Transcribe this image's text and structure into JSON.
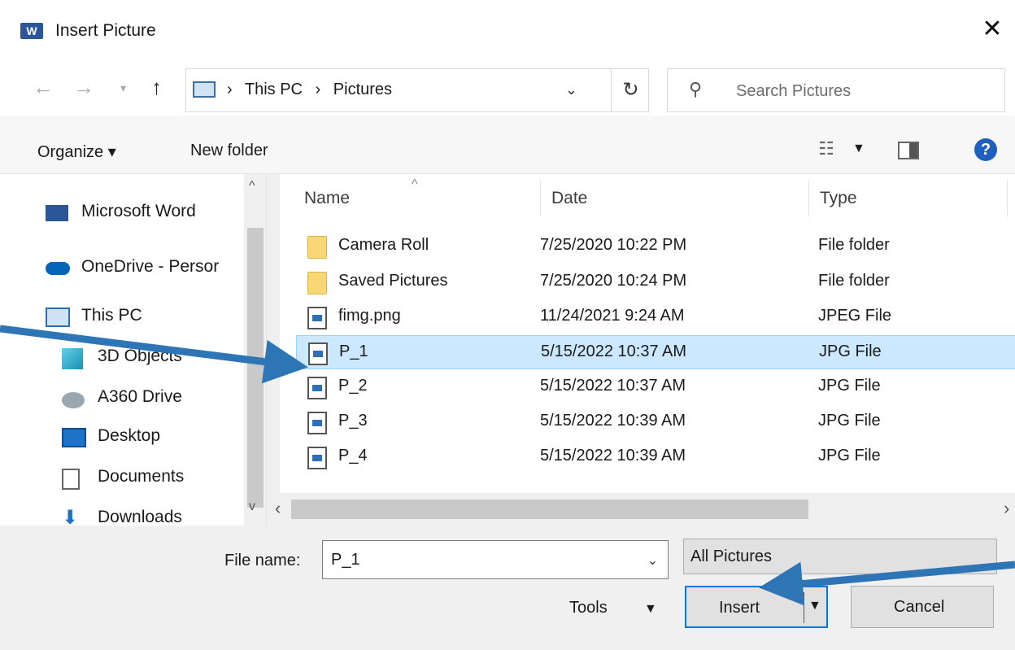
{
  "window": {
    "title": "Insert Picture",
    "app_logo_letter": "W",
    "close_glyph": "✕"
  },
  "address": {
    "crumbs": [
      "This PC",
      "Pictures"
    ],
    "separator": "›",
    "search_placeholder": "Search Pictures"
  },
  "toolbar": {
    "organize_label": "Organize ▾",
    "new_folder_label": "New folder"
  },
  "nav": {
    "items": [
      {
        "label": "Microsoft Word",
        "icon": "word-icon"
      },
      {
        "label": "OneDrive - Persor",
        "icon": "onedrive-cloud-icon"
      },
      {
        "label": "This PC",
        "icon": "monitor-icon"
      },
      {
        "label": "3D Objects",
        "icon": "cube-icon"
      },
      {
        "label": "A360 Drive",
        "icon": "a360-drive-icon"
      },
      {
        "label": "Desktop",
        "icon": "desktop-icon"
      },
      {
        "label": "Documents",
        "icon": "documents-icon"
      },
      {
        "label": "Downloads",
        "icon": "download-arrow-icon"
      }
    ]
  },
  "files": {
    "columns": [
      "Name",
      "Date",
      "Type"
    ],
    "rows": [
      {
        "name": "Camera Roll",
        "date": "7/25/2020 10:22 PM",
        "type": "File folder",
        "kind": "folder"
      },
      {
        "name": "Saved Pictures",
        "date": "7/25/2020 10:24 PM",
        "type": "File folder",
        "kind": "folder"
      },
      {
        "name": "fimg.png",
        "date": "11/24/2021 9:24 AM",
        "type": "JPEG File",
        "kind": "image"
      },
      {
        "name": "P_1",
        "date": "5/15/2022 10:37 AM",
        "type": "JPG File",
        "kind": "image",
        "selected": true
      },
      {
        "name": "P_2",
        "date": "5/15/2022 10:37 AM",
        "type": "JPG File",
        "kind": "image"
      },
      {
        "name": "P_3",
        "date": "5/15/2022 10:39 AM",
        "type": "JPG File",
        "kind": "image"
      },
      {
        "name": "P_4",
        "date": "5/15/2022 10:39 AM",
        "type": "JPG File",
        "kind": "image"
      }
    ]
  },
  "bottom": {
    "file_name_label": "File name:",
    "file_name_value": "P_1",
    "filter_value": "All Pictures",
    "tools_label": "Tools",
    "insert_label": "Insert",
    "cancel_label": "Cancel"
  },
  "colors": {
    "accent": "#0078d7",
    "selection": "#cce8ff",
    "annotation_arrow": "#2e75b6"
  }
}
